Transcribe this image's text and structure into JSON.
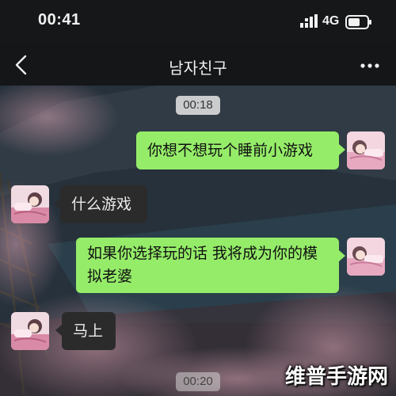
{
  "status_bar": {
    "time": "00:41",
    "network": "4G",
    "signal_icon": "signal-bars-icon",
    "battery_icon": "battery-icon"
  },
  "nav": {
    "back_icon": "chevron-left-icon",
    "title": "남자친구",
    "more_icon": "more-dots-icon"
  },
  "chat": {
    "timestamps": [
      "00:18",
      "00:20"
    ],
    "messages": [
      {
        "side": "sent",
        "text": "你想不想玩个睡前小游戏"
      },
      {
        "side": "received",
        "text": "什么游戏"
      },
      {
        "side": "sent",
        "text": "如果你选择玩的话  我将成为你的模拟老婆"
      },
      {
        "side": "received",
        "text": "马上"
      }
    ]
  },
  "watermark": "维普手游网",
  "colors": {
    "sent_bubble": "#95ec69",
    "received_bubble": "#2b2b2b",
    "header_bg": "#141618"
  }
}
